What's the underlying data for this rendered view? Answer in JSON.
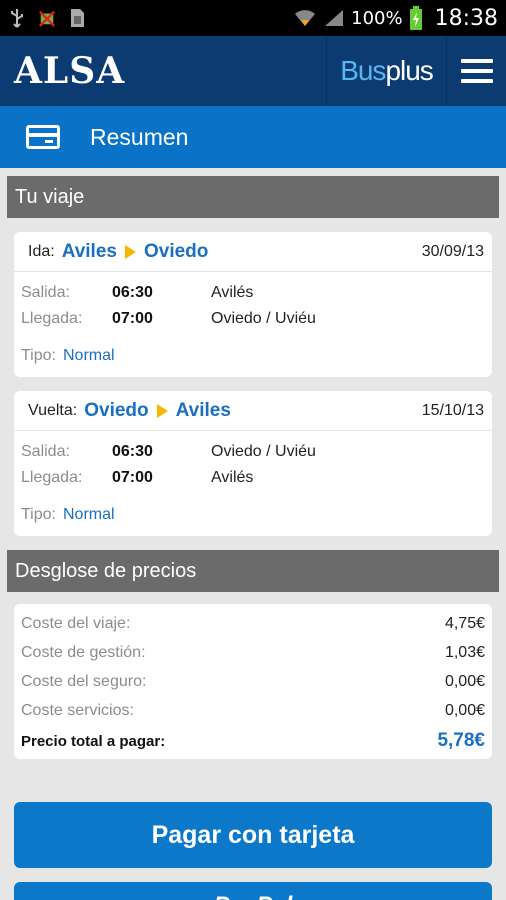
{
  "statusbar": {
    "battery": "100%",
    "time": "18:38"
  },
  "appbar": {
    "logo": "ALSA",
    "brand_a": "Bus",
    "brand_b": "plus"
  },
  "titlebar": {
    "title": "Resumen"
  },
  "trip_section": {
    "title": "Tu viaje"
  },
  "trips": [
    {
      "kind": "Ida:",
      "from": "Aviles",
      "to": "Oviedo",
      "date": "30/09/13",
      "salida_label": "Salida:",
      "salida_time": "06:30",
      "salida_place": "Avilés",
      "llegada_label": "Llegada:",
      "llegada_time": "07:00",
      "llegada_place": "Oviedo / Uviéu",
      "tipo_label": "Tipo:",
      "tipo": "Normal"
    },
    {
      "kind": "Vuelta:",
      "from": "Oviedo",
      "to": "Aviles",
      "date": "15/10/13",
      "salida_label": "Salida:",
      "salida_time": "06:30",
      "salida_place": "Oviedo / Uviéu",
      "llegada_label": "Llegada:",
      "llegada_time": "07:00",
      "llegada_place": "Avilés",
      "tipo_label": "Tipo:",
      "tipo": "Normal"
    }
  ],
  "price_section": {
    "title": "Desglose de precios"
  },
  "prices": [
    {
      "label": "Coste del viaje:",
      "value": "4,75€"
    },
    {
      "label": "Coste de gestión:",
      "value": "1,03€"
    },
    {
      "label": "Coste del seguro:",
      "value": "0,00€"
    },
    {
      "label": "Coste servicios:",
      "value": "0,00€"
    }
  ],
  "total": {
    "label": "Precio total a pagar:",
    "value": "5,78€"
  },
  "buttons": {
    "card": "Pagar con tarjeta",
    "paypal": "PayPal"
  },
  "colors": {
    "appbar": "#0b3b71",
    "accent": "#0a73c7",
    "arrow": "#f5b800",
    "section": "#6b6b6b"
  }
}
